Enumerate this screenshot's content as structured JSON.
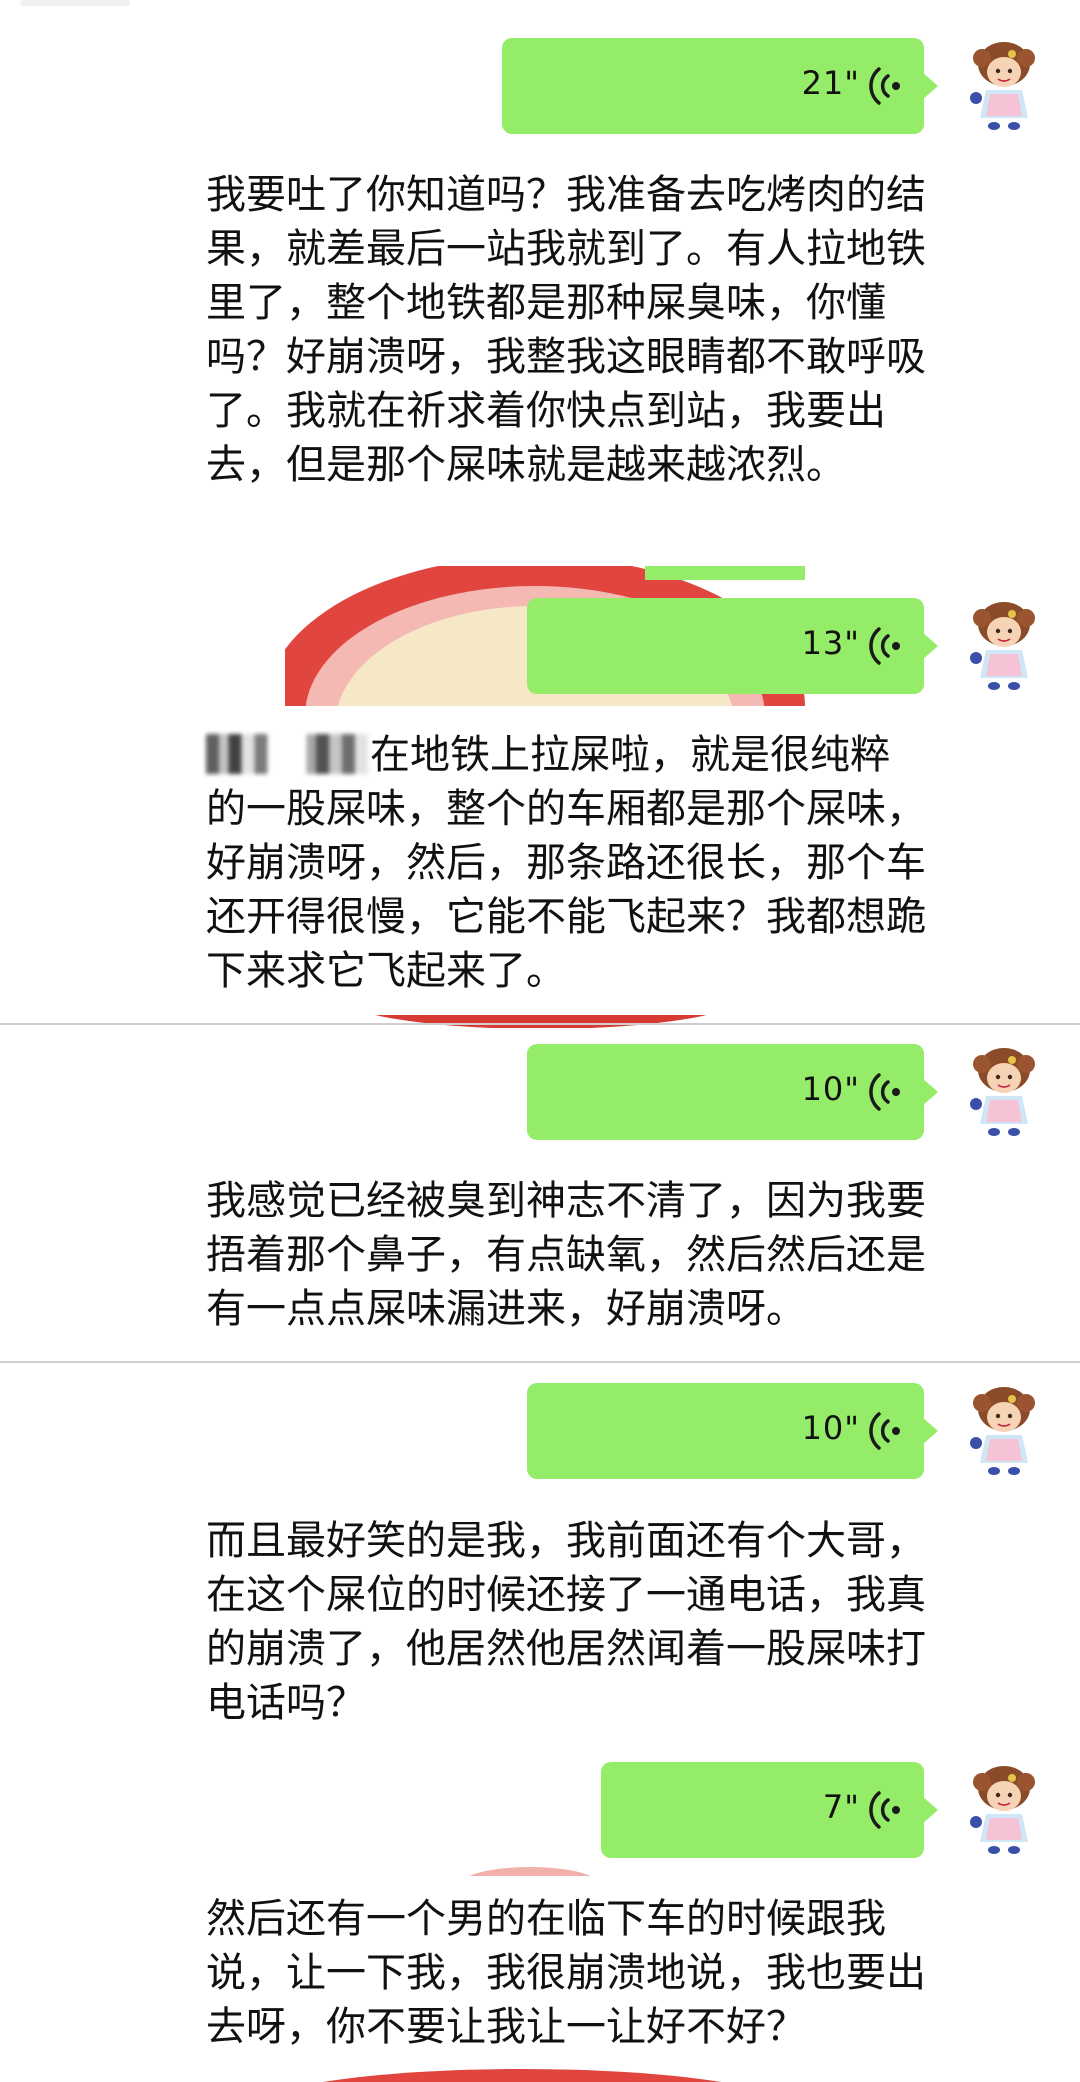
{
  "chat": {
    "messages": [
      {
        "voice_duration": "21\"",
        "transcript": "我要吐了你知道吗？我准备去吃烤肉的结果，就差最后一站我就到了。有人拉地铁里了，整个地铁都是那种屎臭味，你懂吗？好崩溃呀，我整我这眼睛都不敢呼吸了。我就在祈求着你快点到站，我要出去，但是那个屎味就是越来越浓烈。"
      },
      {
        "voice_duration": "13\"",
        "transcript": "在地铁上拉屎啦，就是很纯粹的一股屎味，整个的车厢都是那个屎味，好崩溃呀，然后，那条路还很长，那个车还开得很慢，它能不能飞起来？我都想跪下来求它飞起来了。"
      },
      {
        "voice_duration": "10\"",
        "transcript": "我感觉已经被臭到神志不清了，因为我要捂着那个鼻子，有点缺氧，然后然后还是有一点点屎味漏进来，好崩溃呀。"
      },
      {
        "voice_duration": "10\"",
        "transcript": "而且最好笑的是我，我前面还有个大哥，在这个屎位的时候还接了一通电话，我真的崩溃了，他居然他居然闻着一股屎味打电话吗？"
      },
      {
        "voice_duration": "7\"",
        "transcript": "然后还有一个男的在临下车的时候跟我说，让一下我，我很崩溃地说，我也要出去呀，你不要让我让一让好不好？"
      }
    ]
  },
  "colors": {
    "bubble": "#95ec69",
    "text": "#111111",
    "background": "#ffffff",
    "image_red": "#e0463f"
  },
  "icons": {
    "voice": "voice-wave-icon",
    "avatar": "cartoon-girl-avatar"
  }
}
